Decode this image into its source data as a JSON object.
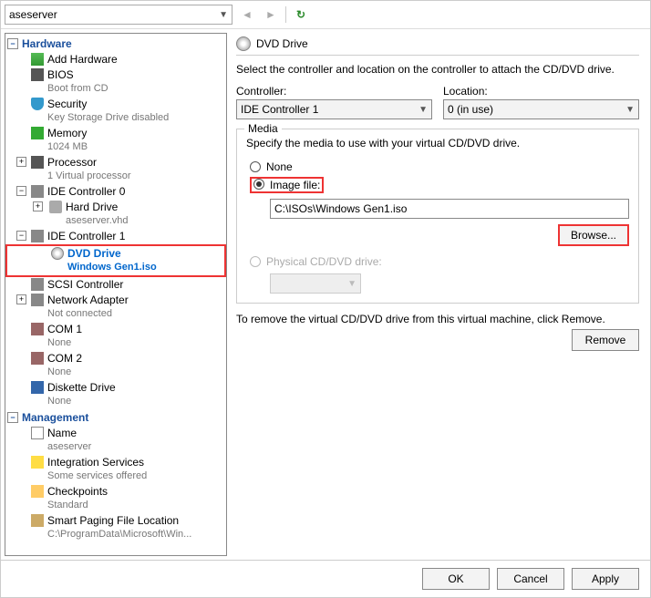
{
  "topbar": {
    "vm_name": "aseserver"
  },
  "sidebar": {
    "hardware_label": "Hardware",
    "management_label": "Management",
    "items": {
      "add_hardware": "Add Hardware",
      "bios": {
        "label": "BIOS",
        "sub": "Boot from CD"
      },
      "security": {
        "label": "Security",
        "sub": "Key Storage Drive disabled"
      },
      "memory": {
        "label": "Memory",
        "sub": "1024 MB"
      },
      "processor": {
        "label": "Processor",
        "sub": "1 Virtual processor"
      },
      "ide0": {
        "label": "IDE Controller 0"
      },
      "hard_drive": {
        "label": "Hard Drive",
        "sub": "aseserver.vhd"
      },
      "ide1": {
        "label": "IDE Controller 1"
      },
      "dvd": {
        "label": "DVD Drive",
        "sub": "Windows Gen1.iso"
      },
      "scsi": {
        "label": "SCSI Controller"
      },
      "net": {
        "label": "Network Adapter",
        "sub": "Not connected"
      },
      "com1": {
        "label": "COM 1",
        "sub": "None"
      },
      "com2": {
        "label": "COM 2",
        "sub": "None"
      },
      "diskette": {
        "label": "Diskette Drive",
        "sub": "None"
      },
      "name": {
        "label": "Name",
        "sub": "aseserver"
      },
      "integration": {
        "label": "Integration Services",
        "sub": "Some services offered"
      },
      "checkpoints": {
        "label": "Checkpoints",
        "sub": "Standard"
      },
      "paging": {
        "label": "Smart Paging File Location",
        "sub": "C:\\ProgramData\\Microsoft\\Win..."
      }
    }
  },
  "main": {
    "title": "DVD Drive",
    "description": "Select the controller and location on the controller to attach the CD/DVD drive.",
    "controller_label": "Controller:",
    "controller_value": "IDE Controller 1",
    "location_label": "Location:",
    "location_value": "0 (in use)",
    "media": {
      "legend": "Media",
      "desc": "Specify the media to use with your virtual CD/DVD drive.",
      "none_label": "None",
      "image_label": "Image file:",
      "image_path": "C:\\ISOs\\Windows Gen1.iso",
      "browse_label": "Browse...",
      "physical_label": "Physical CD/DVD drive:"
    },
    "remove_desc": "To remove the virtual CD/DVD drive from this virtual machine, click Remove.",
    "remove_label": "Remove"
  },
  "footer": {
    "ok": "OK",
    "cancel": "Cancel",
    "apply": "Apply"
  }
}
